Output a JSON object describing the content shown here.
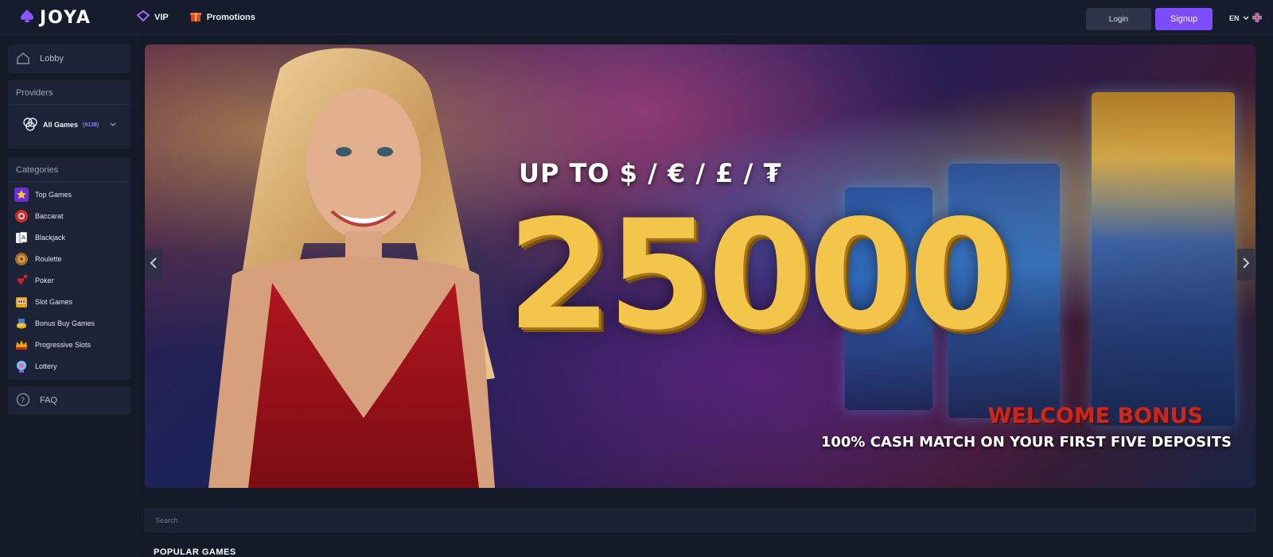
{
  "header": {
    "logo_text": "JOYA",
    "nav": [
      {
        "label": "VIP",
        "icon": "diamond-icon"
      },
      {
        "label": "Promotions",
        "icon": "gift-icon"
      }
    ],
    "login_label": "Login",
    "signup_label": "Signup",
    "language": "EN"
  },
  "sidebar": {
    "lobby_label": "Lobby",
    "providers_title": "Providers",
    "all_games_label": "All Games",
    "all_games_count": "(9138)",
    "categories_title": "Categories",
    "categories": [
      {
        "label": "Top Games",
        "icon": "star-icon"
      },
      {
        "label": "Baccarat",
        "icon": "chip-icon"
      },
      {
        "label": "Blackjack",
        "icon": "cards-icon"
      },
      {
        "label": "Roulette",
        "icon": "roulette-icon"
      },
      {
        "label": "Poker",
        "icon": "poker-icon"
      },
      {
        "label": "Slot Games",
        "icon": "slot-machine-icon"
      },
      {
        "label": "Bonus Buy Games",
        "icon": "coin-stack-icon"
      },
      {
        "label": "Progressive Slots",
        "icon": "crown-icon"
      },
      {
        "label": "Lottery",
        "icon": "lottery-ball-icon"
      }
    ],
    "faq_label": "FAQ"
  },
  "banner": {
    "line1": "UP TO $ / € / £ / ₮",
    "amount": "25000",
    "bonus_title": "WELCOME BONUS",
    "bonus_sub": "100% CASH MATCH ON YOUR FIRST FIVE DEPOSITS"
  },
  "search": {
    "placeholder": "Search"
  },
  "sections": {
    "popular_title": "POPULAR GAMES"
  },
  "colors": {
    "accent": "#7b4dff",
    "background": "#141a28",
    "card": "#1c2336",
    "gold": "#f3c54a",
    "bonus_red": "#c7281f"
  }
}
